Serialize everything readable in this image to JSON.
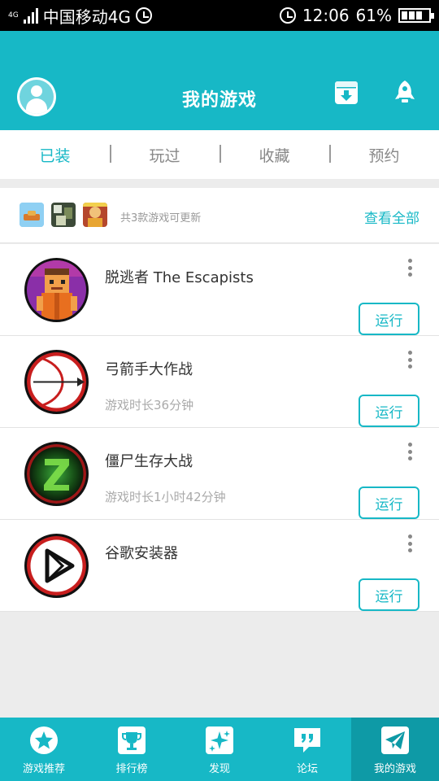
{
  "status_bar": {
    "network_type": "4G",
    "carrier": "中国移动4G",
    "time": "12:06",
    "battery": "61%"
  },
  "header": {
    "title": "我的游戏"
  },
  "tabs": [
    {
      "label": "已装",
      "active": true
    },
    {
      "label": "玩过",
      "active": false
    },
    {
      "label": "收藏",
      "active": false
    },
    {
      "label": "预约",
      "active": false
    }
  ],
  "update_bar": {
    "text": "共3款游戏可更新",
    "view_all": "查看全部"
  },
  "games": [
    {
      "name": "脱逃者 The Escapists",
      "playtime": "",
      "action": "运行",
      "icon": "escapists-icon"
    },
    {
      "name": "弓箭手大作战",
      "playtime": "游戏时长36分钟",
      "action": "运行",
      "icon": "archery-icon"
    },
    {
      "name": "僵尸生存大战",
      "playtime": "游戏时长1小时42分钟",
      "action": "运行",
      "icon": "zombie-icon"
    },
    {
      "name": "谷歌安装器",
      "playtime": "",
      "action": "运行",
      "icon": "play-store-icon"
    }
  ],
  "bottom_nav": [
    {
      "label": "游戏推荐",
      "icon": "star-icon",
      "active": false
    },
    {
      "label": "排行榜",
      "icon": "trophy-icon",
      "active": false
    },
    {
      "label": "发现",
      "icon": "sparkle-icon",
      "active": false
    },
    {
      "label": "论坛",
      "icon": "forum-icon",
      "active": false
    },
    {
      "label": "我的游戏",
      "icon": "paper-plane-icon",
      "active": true
    }
  ],
  "colors": {
    "accent": "#17b8c6",
    "accent_dark": "#0e9aa6",
    "background": "#ececec"
  }
}
